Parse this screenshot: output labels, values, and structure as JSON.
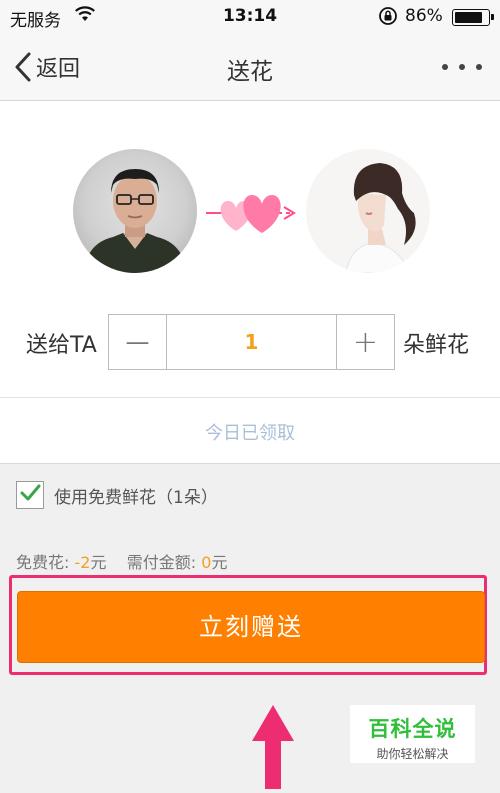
{
  "status_bar": {
    "carrier": "无服务",
    "time": "13:14",
    "battery_percent_text": "86%",
    "battery_level": 0.86,
    "icons": [
      "wifi-icon",
      "rotation-lock-icon",
      "battery-icon"
    ]
  },
  "nav": {
    "back_label": "返回",
    "title": "送花",
    "icons": [
      "chevron-left-icon",
      "more-dots-icon"
    ]
  },
  "gift": {
    "avatars": [
      "sender-avatar",
      "recipient-avatar"
    ],
    "connector_icon": "heart-arrow-icon",
    "send_to_label": "送给TA",
    "quantity": "1",
    "unit_label": "朵鲜花",
    "minus_symbol": "—",
    "plus_symbol": "+",
    "received_today": "今日已领取"
  },
  "options": {
    "use_free_label": "使用免费鲜花（1朵）",
    "use_free_checked": true
  },
  "summary": {
    "free_label": "免费花: ",
    "free_value": "-2",
    "free_unit": "元",
    "pay_label": "需付金额: ",
    "pay_value": "0",
    "pay_unit": "元"
  },
  "actions": {
    "send_label": "立刻赠送"
  },
  "watermark": {
    "title": "百科全说",
    "subtitle": "助你轻松解决"
  },
  "colors": {
    "accent_orange": "#ff8000",
    "value_orange": "#f2a11b",
    "annotation_pink": "#ee2c71",
    "check_green": "#3aa548",
    "watermark_green": "#2fbf3a"
  }
}
